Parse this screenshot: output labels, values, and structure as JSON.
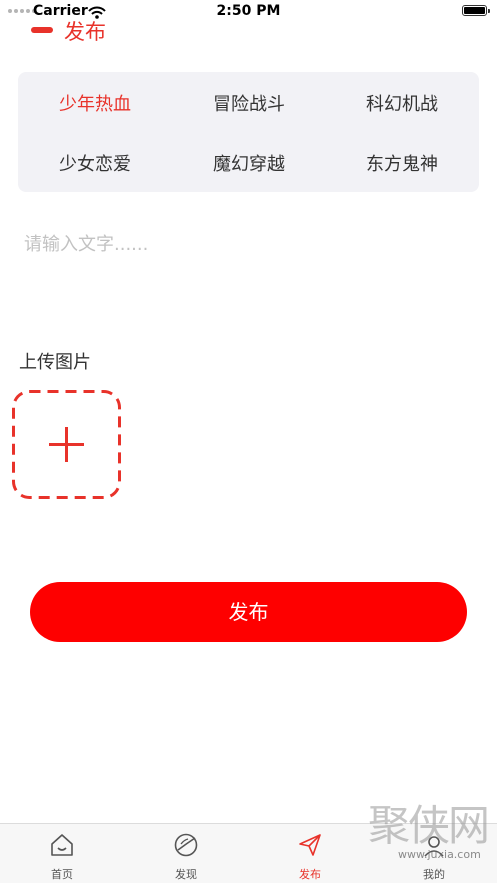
{
  "status_bar": {
    "carrier": "Carrier",
    "time": "2:50 PM"
  },
  "header": {
    "title": "发布"
  },
  "categories": [
    "少年热血",
    "冒险战斗",
    "科幻机战",
    "少女恋爱",
    "魔幻穿越",
    "东方鬼神"
  ],
  "selected_category": "少年热血",
  "content_input": {
    "placeholder": "请输入文字......",
    "value": ""
  },
  "upload": {
    "label": "上传图片"
  },
  "publish_button": {
    "label": "发布"
  },
  "tab_bar": {
    "tabs": [
      {
        "label": "首页",
        "icon": "home-icon"
      },
      {
        "label": "发现",
        "icon": "planet-icon"
      },
      {
        "label": "发布",
        "icon": "paper-plane-icon"
      },
      {
        "label": "我的",
        "icon": "profile-icon"
      }
    ],
    "active": "发布"
  },
  "watermark": {
    "text": "聚侠网",
    "url": "www.juxia.com"
  },
  "colors": {
    "accent": "#e8322a",
    "button": "#fe0000",
    "panel": "#f2f2f6"
  }
}
